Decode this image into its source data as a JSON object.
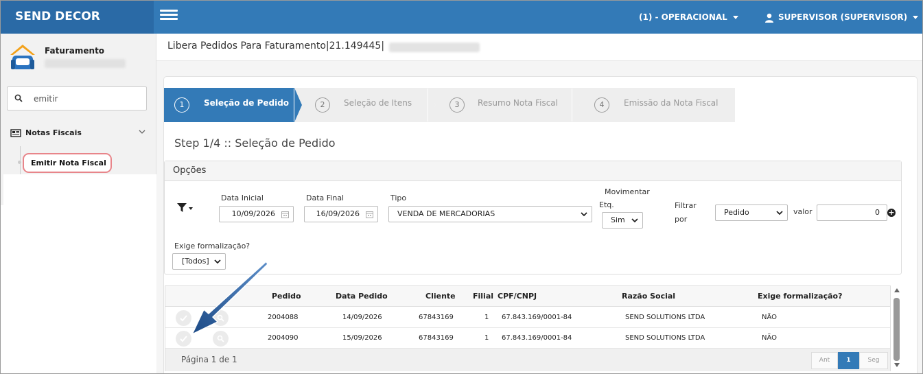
{
  "app": {
    "brand": "SEND DECOR"
  },
  "topbar": {
    "company": "(1) - OPERACIONAL",
    "user": "SUPERVISOR (SUPERVISOR)",
    "icons": {
      "menu": "hamburger-icon",
      "user": "user-icon"
    }
  },
  "sidebar": {
    "title": "Faturamento",
    "search": {
      "value": "emitir"
    },
    "group": "Notas Fiscais",
    "item": "Emitir Nota Fiscal"
  },
  "page": {
    "title": "Libera Pedidos Para Faturamento|21.149445|"
  },
  "wizard": {
    "steps": [
      {
        "num": "1",
        "label": "Seleção de Pedido"
      },
      {
        "num": "2",
        "label": "Seleção de Itens"
      },
      {
        "num": "3",
        "label": "Resumo Nota Fiscal"
      },
      {
        "num": "4",
        "label": "Emissão da Nota Fiscal"
      }
    ],
    "heading": "Step 1/4 :: Seleção de Pedido"
  },
  "options": {
    "header": "Opções",
    "data_inicial": {
      "label": "Data Inicial",
      "value": "10/09/2026"
    },
    "data_final": {
      "label": "Data Final",
      "value": "16/09/2026"
    },
    "tipo": {
      "label": "Tipo",
      "value": "VENDA DE MERCADORIAS"
    },
    "movimentar": {
      "label_1": "Movimentar",
      "label_2": "Etq.",
      "value": "Sim"
    },
    "filtrar": {
      "label_1": "Filtrar",
      "label_2": "por",
      "value": "Pedido"
    },
    "valor": {
      "label": "valor",
      "value": "0"
    },
    "exige": {
      "label": "Exige formalização?",
      "value": "[Todos]"
    }
  },
  "grid": {
    "columns": [
      "Pedido",
      "Data Pedido",
      "Cliente",
      "Filial",
      "CPF/CNPJ",
      "Razão Social",
      "Exige formalização?"
    ],
    "rows": [
      {
        "pedido": "2004088",
        "data": "14/09/2026",
        "cliente": "67843169",
        "filial": "1",
        "cnpj": "67.843.169/0001-84",
        "razao": "SEND SOLUTIONS LTDA",
        "exige": "NÃO"
      },
      {
        "pedido": "2004090",
        "data": "15/09/2026",
        "cliente": "67843169",
        "filial": "1",
        "cnpj": "67.843.169/0001-84",
        "razao": "SEND SOLUTIONS LTDA",
        "exige": "NÃO"
      }
    ],
    "page_info": "Página 1 de 1",
    "pager": {
      "prev": "Ant",
      "current": "1",
      "next": "Seg"
    }
  },
  "colors": {
    "primary": "#337ab7",
    "brand_bg": "#2a6aa6",
    "highlight": "#e8858a",
    "annotation_arrow": "#1f4e86"
  }
}
